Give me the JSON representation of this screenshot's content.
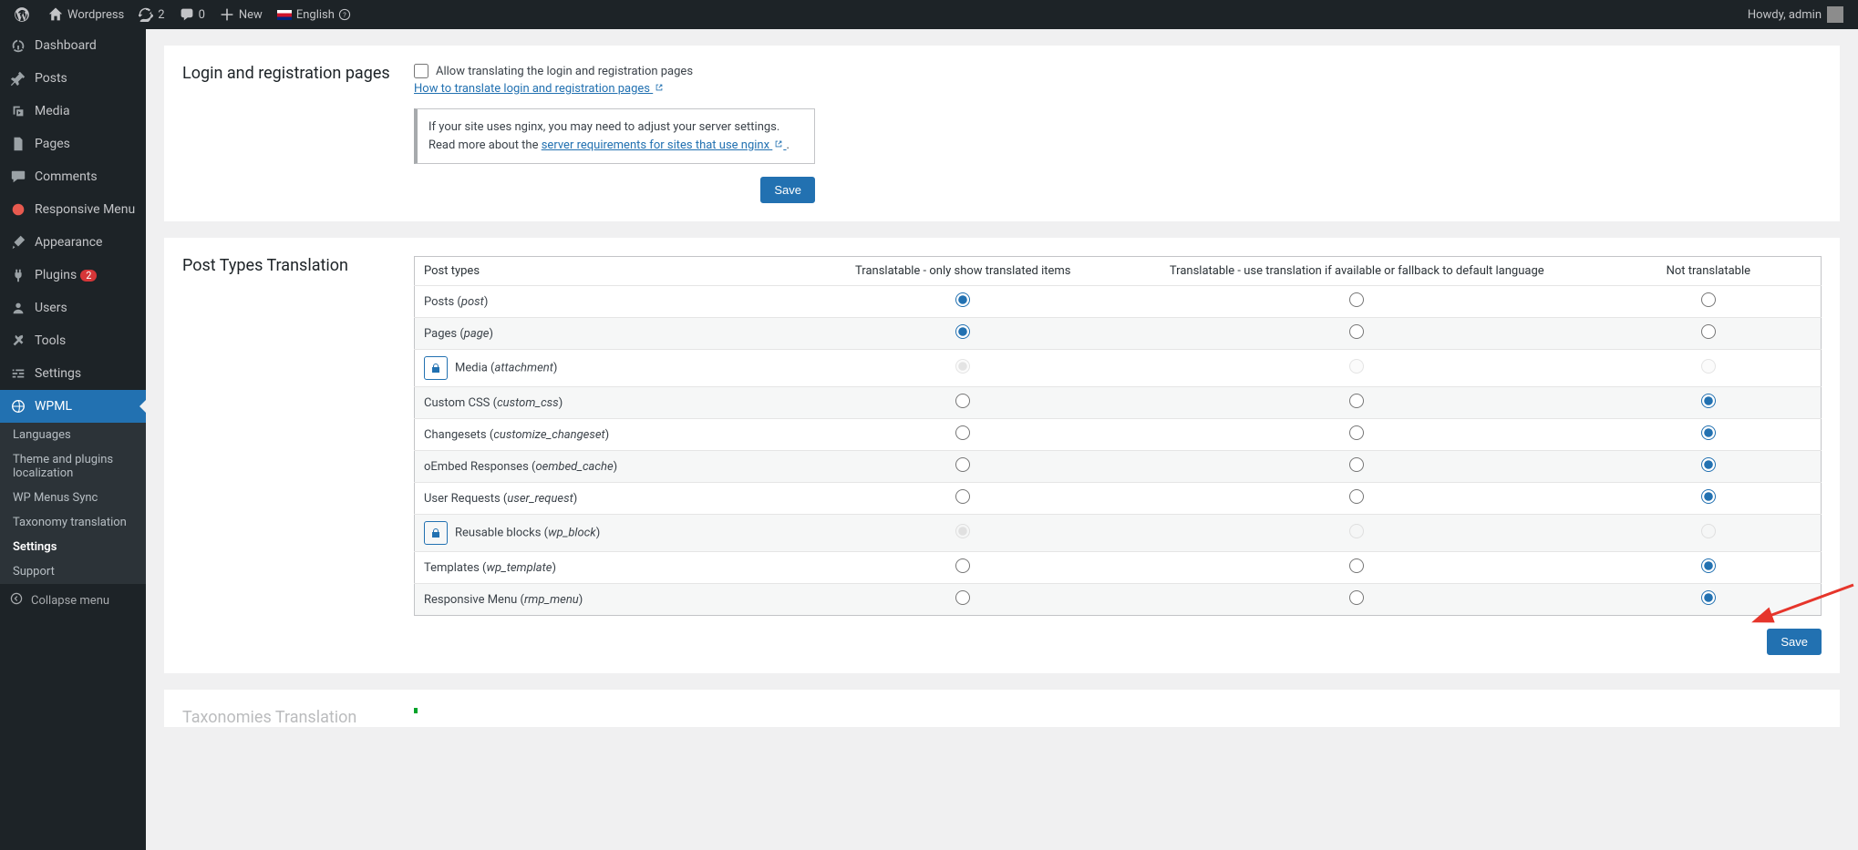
{
  "adminbar": {
    "site_name": "Wordpress",
    "updates": "2",
    "comments": "0",
    "new": "New",
    "language": "English",
    "greeting": "Howdy, admin"
  },
  "sidebar": {
    "items": [
      {
        "label": "Dashboard"
      },
      {
        "label": "Posts"
      },
      {
        "label": "Media"
      },
      {
        "label": "Pages"
      },
      {
        "label": "Comments"
      },
      {
        "label": "Responsive Menu"
      },
      {
        "label": "Appearance"
      },
      {
        "label": "Plugins",
        "badge": "2"
      },
      {
        "label": "Users"
      },
      {
        "label": "Tools"
      },
      {
        "label": "Settings"
      },
      {
        "label": "WPML"
      }
    ],
    "submenu": [
      {
        "label": "Languages"
      },
      {
        "label": "Theme and plugins localization"
      },
      {
        "label": "WP Menus Sync"
      },
      {
        "label": "Taxonomy translation"
      },
      {
        "label": "Settings"
      },
      {
        "label": "Support"
      }
    ],
    "collapse": "Collapse menu"
  },
  "login_section": {
    "heading": "Login and registration pages",
    "checkbox_label": "Allow translating the login and registration pages",
    "howto_link": "How to translate login and registration pages",
    "nginx_note_1": "If your site uses nginx, you may need to adjust your server settings. Read more about the ",
    "nginx_link": "server requirements for sites that use nginx",
    "save": "Save"
  },
  "pt_section": {
    "heading": "Post Types Translation",
    "headers": {
      "name": "Post types",
      "col1": "Translatable - only show translated items",
      "col2": "Translatable - use translation if available or fallback to default language",
      "col3": "Not translatable"
    },
    "rows": [
      {
        "name": "Posts",
        "slug": "post",
        "locked": false,
        "sel": 0
      },
      {
        "name": "Pages",
        "slug": "page",
        "locked": false,
        "sel": 0
      },
      {
        "name": "Media",
        "slug": "attachment",
        "locked": true,
        "sel": 0
      },
      {
        "name": "Custom CSS",
        "slug": "custom_css",
        "locked": false,
        "sel": 2
      },
      {
        "name": "Changesets",
        "slug": "customize_changeset",
        "locked": false,
        "sel": 2
      },
      {
        "name": "oEmbed Responses",
        "slug": "oembed_cache",
        "locked": false,
        "sel": 2
      },
      {
        "name": "User Requests",
        "slug": "user_request",
        "locked": false,
        "sel": 2
      },
      {
        "name": "Reusable blocks",
        "slug": "wp_block",
        "locked": true,
        "sel": 0
      },
      {
        "name": "Templates",
        "slug": "wp_template",
        "locked": false,
        "sel": 2
      },
      {
        "name": "Responsive Menu",
        "slug": "rmp_menu",
        "locked": false,
        "sel": 2
      }
    ],
    "save": "Save"
  },
  "tax_section": {
    "heading": "Taxonomies Translation"
  }
}
